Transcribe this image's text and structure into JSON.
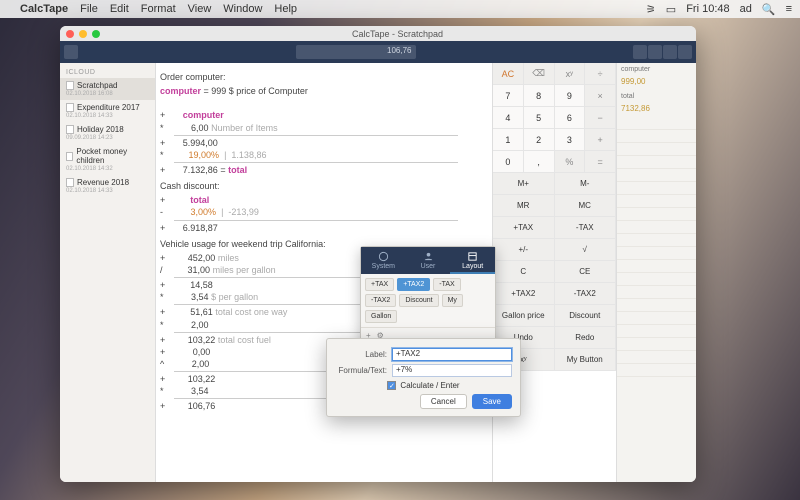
{
  "menubar": {
    "app": "CalcTape",
    "items": [
      "File",
      "Edit",
      "Format",
      "View",
      "Window",
      "Help"
    ],
    "clock": "Fri 10:48",
    "user": "ad"
  },
  "window": {
    "title": "CalcTape - Scratchpad",
    "display": "106,76"
  },
  "sidebar": {
    "section": "ICLOUD",
    "items": [
      {
        "name": "Scratchpad",
        "date": "02.10.2018 16:08",
        "sel": true
      },
      {
        "name": "Expenditure 2017",
        "date": "02.10.2018 14:33"
      },
      {
        "name": "Holiday 2018",
        "date": "09.09.2018 14:23"
      },
      {
        "name": "Pocket money children",
        "date": "02.10.2018 14:32"
      },
      {
        "name": "Revenue 2018",
        "date": "02.10.2018 14:33"
      }
    ]
  },
  "tape": {
    "s1_title": "Order computer:",
    "s1_var": "computer",
    "s1_var_line": " = 999 $ price of Computer",
    "s1_l1_op": "+",
    "s1_l1_kw": "computer",
    "s1_l2_op": "*",
    "s1_l2_val": "6,00",
    "s1_l2_cm": "Number of Items",
    "s1_l3_op": "+",
    "s1_l3_val": "5.994,00",
    "s1_l4_op": "*",
    "s1_l4_val": "19,00%",
    "s1_l4_res": "1.138,86",
    "s1_l5_op": "+",
    "s1_l5_val": "7.132,86",
    "s1_l5_eq": "total",
    "s2_title": "Cash discount:",
    "s2_l1_op": "+",
    "s2_l1_kw": "total",
    "s2_l2_op": "-",
    "s2_l2_val": "3,00%",
    "s2_l2_res": "-213,99",
    "s2_l3_op": "+",
    "s2_l3_val": "6.918,87",
    "s3_title": "Vehicle usage for weekend trip California:",
    "s3_l1_op": "+",
    "s3_l1_val": "452,00",
    "s3_l1_cm": "miles",
    "s3_l2_op": "/",
    "s3_l2_val": "31,00",
    "s3_l2_cm": "miles per gallon",
    "s3_l3_op": "+",
    "s3_l3_val": "14,58",
    "s3_l4_op": "*",
    "s3_l4_val": "3,54",
    "s3_l4_cm": "$ per gallon",
    "s3_l5_op": "+",
    "s3_l5_val": "51,61",
    "s3_l5_cm": "total cost one way",
    "s3_l6_op": "*",
    "s3_l6_val": "2,00",
    "s3_l7_op": "+",
    "s3_l7_val": "103,22",
    "s3_l7_cm": "total cost fuel",
    "s3_l8_op": "+",
    "s3_l8_val": "0,00",
    "s3_l9_op": "^",
    "s3_l9_val": "2,00",
    "s3_l10_op": "+",
    "s3_l10_val": "103,22",
    "s3_l11_op": "*",
    "s3_l11_val": "3,54",
    "s3_l12_op": "+",
    "s3_l12_val": "106,76"
  },
  "keypad": {
    "r0": [
      "AC",
      "⌫",
      "xʸ",
      "÷"
    ],
    "r1": [
      "7",
      "8",
      "9",
      "×"
    ],
    "r2": [
      "4",
      "5",
      "6",
      "−"
    ],
    "r3": [
      "1",
      "2",
      "3",
      "+"
    ],
    "r4": [
      "0",
      ",",
      "%",
      "="
    ],
    "mem": [
      "M+",
      "M-",
      "MR",
      "MC"
    ],
    "tax": [
      "+TAX",
      "-TAX"
    ],
    "fn1": [
      "+/-",
      "√"
    ],
    "fn2": [
      "C",
      "CE"
    ],
    "tax2": [
      "+TAX2",
      "-TAX2"
    ],
    "gp": [
      "Gallon price",
      "Discount"
    ],
    "ur": [
      "Undo",
      "Redo"
    ],
    "last": [
      "xʸ",
      "My Button"
    ]
  },
  "labels": {
    "l1_h": "computer",
    "l1_v": "999,00",
    "l2_h": "total",
    "l2_v": "7132,86"
  },
  "panel": {
    "tabs": [
      "System",
      "User",
      "Layout"
    ],
    "chips": [
      "+TAX",
      "+TAX2",
      "-TAX",
      "-TAX2",
      "Discount",
      "My",
      "Gallon"
    ],
    "plus": "+",
    "gear": "⚙︎",
    "cancel": "ancel",
    "save": "Save"
  },
  "dialog": {
    "label_lbl": "Label:",
    "label_val": "+TAX2",
    "formula_lbl": "Formula/Text:",
    "formula_val": "+7%",
    "calc": "Calculate / Enter",
    "cancel": "Cancel",
    "save": "Save"
  }
}
